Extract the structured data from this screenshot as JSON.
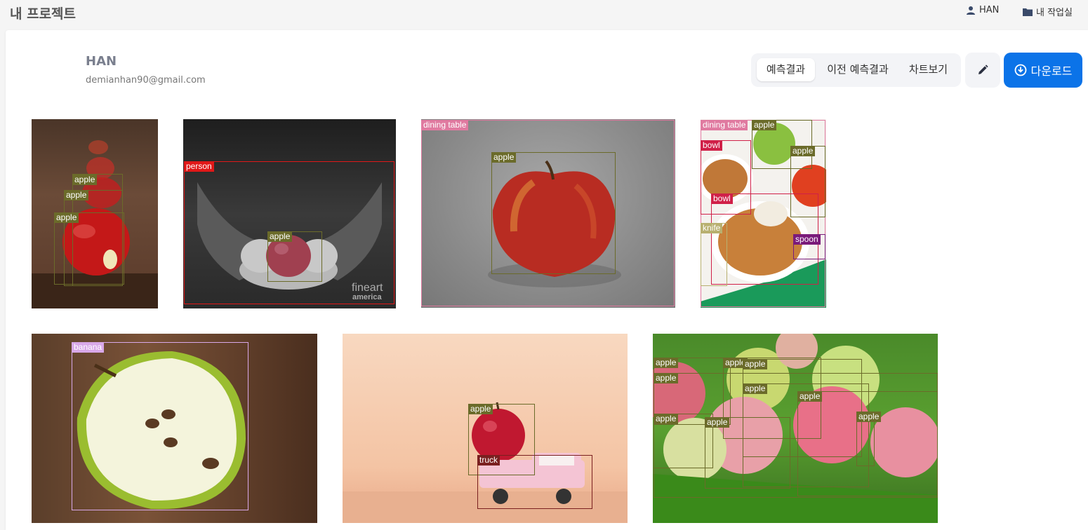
{
  "header": {
    "title": "내 프로젝트",
    "user_label": "HAN",
    "workspace_label": "내 작업실"
  },
  "profile": {
    "name": "HAN",
    "email": "demianhan90@gmail.com"
  },
  "tabs": [
    {
      "label": "예측결과",
      "active": true
    },
    {
      "label": "이전 예측결과",
      "active": false
    },
    {
      "label": "차트보기",
      "active": false
    }
  ],
  "actions": {
    "edit_icon": "pencil-icon",
    "download_label": "다운로드",
    "download_icon": "download-circle-icon"
  },
  "colors": {
    "accent": "#0b73e8",
    "apple": "#6b6b2a",
    "person": "#e01818",
    "dining_table": "#e07aa0",
    "bowl": "#d02048",
    "spoon": "#7a1a7a",
    "knife": "#b8b070",
    "banana": "#d8a8e8",
    "truck": "#7a2020"
  },
  "images": [
    {
      "id": "img1",
      "labels": [
        "apple",
        "apple",
        "apple"
      ]
    },
    {
      "id": "img2",
      "labels": [
        "person",
        "apple"
      ],
      "watermark": [
        "fineart",
        "america"
      ]
    },
    {
      "id": "img3",
      "labels": [
        "dining table",
        "apple"
      ]
    },
    {
      "id": "img4",
      "labels": [
        "dining table",
        "apple",
        "bowl",
        "apple",
        "bowl",
        "knife",
        "spoon"
      ]
    },
    {
      "id": "img5",
      "labels": [
        "banana"
      ]
    },
    {
      "id": "img6",
      "labels": [
        "apple",
        "truck"
      ]
    },
    {
      "id": "img7",
      "labels": [
        "apple",
        "apple",
        "apple",
        "apple",
        "apple",
        "apple",
        "apple",
        "apple",
        "apple"
      ]
    }
  ]
}
